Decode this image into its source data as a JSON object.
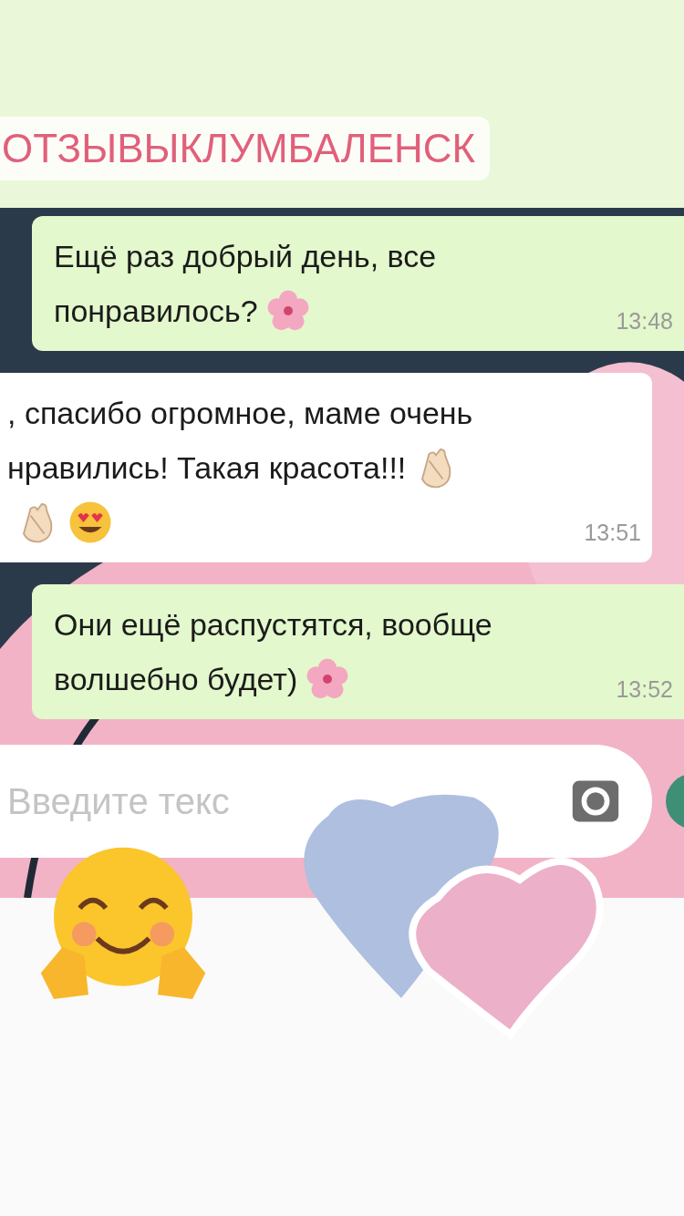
{
  "hashtag": "ОТЗЫВЫКЛУМБАЛЕНСК",
  "messages": [
    {
      "kind": "sent",
      "lines": [
        {
          "text": "Ещё раз добрый день, все"
        },
        {
          "text": "понравилось?",
          "emoji": [
            {
              "kind": "flower"
            }
          ]
        }
      ],
      "time": "13:48"
    },
    {
      "kind": "received",
      "lines": [
        {
          "text": ", спасибо огромное, маме очень"
        },
        {
          "text": "нравились! Такая красота!!!",
          "emoji": [
            {
              "kind": "clap"
            }
          ]
        },
        {
          "emoji": [
            {
              "kind": "clap"
            },
            {
              "kind": "heart-eyes"
            }
          ]
        }
      ],
      "time": "13:51"
    },
    {
      "kind": "sent",
      "lines": [
        {
          "text": "Они ещё распустятся, вообще"
        },
        {
          "text": "волшебно будет)",
          "emoji": [
            {
              "kind": "flower"
            }
          ]
        }
      ],
      "time": "13:52"
    }
  ],
  "input": {
    "placeholder": "Введите текс"
  }
}
